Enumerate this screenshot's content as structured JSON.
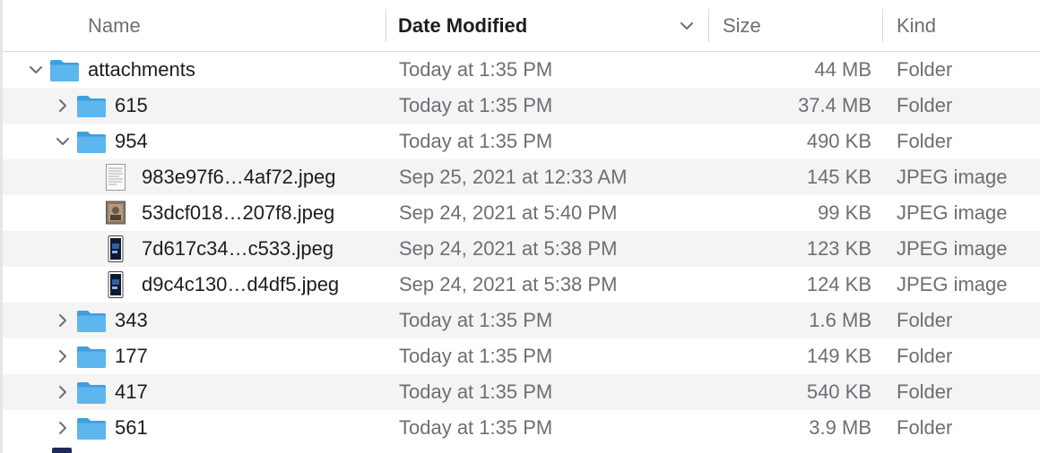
{
  "columns": {
    "name": "Name",
    "date": "Date Modified",
    "size": "Size",
    "kind": "Kind"
  },
  "sort_indicator_icon": "chevron-down-icon",
  "rows": [
    {
      "level": 0,
      "type": "folder",
      "expanded": true,
      "name": "attachments",
      "date": "Today at 1:35 PM",
      "size": "44 MB",
      "kind": "Folder"
    },
    {
      "level": 1,
      "type": "folder",
      "expanded": false,
      "name": "615",
      "date": "Today at 1:35 PM",
      "size": "37.4 MB",
      "kind": "Folder"
    },
    {
      "level": 1,
      "type": "folder",
      "expanded": true,
      "name": "954",
      "date": "Today at 1:35 PM",
      "size": "490 KB",
      "kind": "Folder"
    },
    {
      "level": 2,
      "type": "file",
      "thumb": "document-thumbnail",
      "name": "983e97f6…4af72.jpeg",
      "date": "Sep 25, 2021 at 12:33 AM",
      "size": "145 KB",
      "kind": "JPEG image"
    },
    {
      "level": 2,
      "type": "file",
      "thumb": "photo-thumbnail",
      "name": "53dcf018…207f8.jpeg",
      "date": "Sep 24, 2021 at 5:40 PM",
      "size": "99 KB",
      "kind": "JPEG image"
    },
    {
      "level": 2,
      "type": "file",
      "thumb": "phone-screenshot-thumbnail",
      "name": "7d617c34…c533.jpeg",
      "date": "Sep 24, 2021 at 5:38 PM",
      "size": "123 KB",
      "kind": "JPEG image"
    },
    {
      "level": 2,
      "type": "file",
      "thumb": "phone-screenshot-thumbnail",
      "name": "d9c4c130…d4df5.jpeg",
      "date": "Sep 24, 2021 at 5:38 PM",
      "size": "124 KB",
      "kind": "JPEG image"
    },
    {
      "level": 1,
      "type": "folder",
      "expanded": false,
      "name": "343",
      "date": "Today at 1:35 PM",
      "size": "1.6 MB",
      "kind": "Folder"
    },
    {
      "level": 1,
      "type": "folder",
      "expanded": false,
      "name": "177",
      "date": "Today at 1:35 PM",
      "size": "149 KB",
      "kind": "Folder"
    },
    {
      "level": 1,
      "type": "folder",
      "expanded": false,
      "name": "417",
      "date": "Today at 1:35 PM",
      "size": "540 KB",
      "kind": "Folder"
    },
    {
      "level": 1,
      "type": "folder",
      "expanded": false,
      "name": "561",
      "date": "Today at 1:35 PM",
      "size": "3.9 MB",
      "kind": "Folder"
    }
  ],
  "colors": {
    "folder_front": "#5db6ee",
    "folder_back": "#3f9ee0",
    "row_alt": "#f4f4f5",
    "secondary_text": "#6e6e73"
  }
}
